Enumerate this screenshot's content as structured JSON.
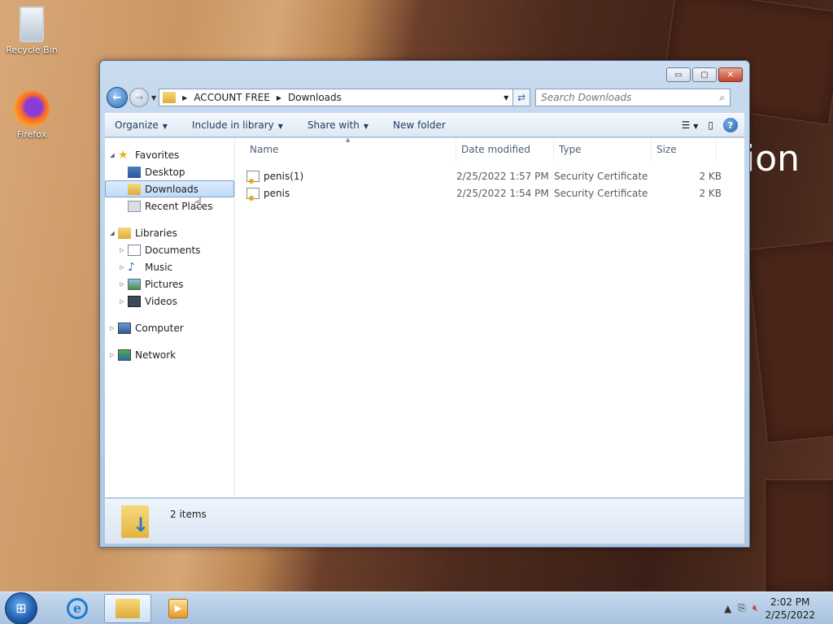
{
  "desktop": {
    "icons": [
      {
        "label": "Recycle Bin",
        "icon": "recycle-bin-icon"
      },
      {
        "label": "Firefox",
        "icon": "firefox-icon"
      }
    ],
    "wallpaper_text": "ion"
  },
  "window": {
    "caption": {
      "minimize": "▭",
      "maximize": "▢",
      "close": "✕"
    },
    "address": {
      "crumbs": [
        "ACCOUNT FREE",
        "Downloads"
      ]
    },
    "search": {
      "placeholder": "Search Downloads"
    },
    "toolbar": {
      "organize": "Organize",
      "include": "Include in library",
      "share": "Share with",
      "new_folder": "New folder"
    },
    "navpane": {
      "favorites": "Favorites",
      "desktop": "Desktop",
      "downloads": "Downloads",
      "recent": "Recent Places",
      "libraries": "Libraries",
      "documents": "Documents",
      "music": "Music",
      "pictures": "Pictures",
      "videos": "Videos",
      "computer": "Computer",
      "network": "Network"
    },
    "columns": {
      "name": "Name",
      "date": "Date modified",
      "type": "Type",
      "size": "Size"
    },
    "files": [
      {
        "name": "penis(1)",
        "date": "2/25/2022 1:57 PM",
        "type": "Security Certificate",
        "size": "2 KB"
      },
      {
        "name": "penis",
        "date": "2/25/2022 1:54 PM",
        "type": "Security Certificate",
        "size": "2 KB"
      }
    ],
    "details": {
      "count": "2 items"
    }
  },
  "taskbar": {
    "time": "2:02 PM",
    "date": "2/25/2022"
  }
}
